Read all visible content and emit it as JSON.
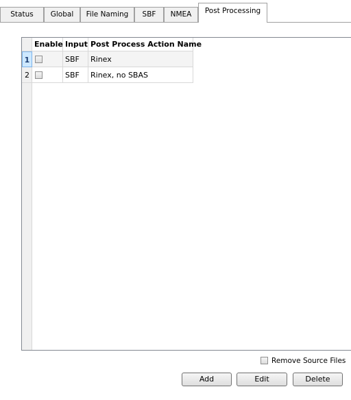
{
  "tabs": [
    {
      "label": "Status"
    },
    {
      "label": "Global"
    },
    {
      "label": "File Naming"
    },
    {
      "label": "SBF"
    },
    {
      "label": "NMEA"
    },
    {
      "label": "Post Processing",
      "active": true
    }
  ],
  "table": {
    "columns": [
      "Enable",
      "Input",
      "Post Process Action Name"
    ],
    "rows": [
      {
        "num": "1",
        "enabled": false,
        "input": "SBF",
        "name": "Rinex"
      },
      {
        "num": "2",
        "enabled": false,
        "input": "SBF",
        "name": "Rinex, no SBAS"
      }
    ]
  },
  "options": {
    "remove_source_files_label": "Remove Source Files",
    "remove_source_files_checked": false
  },
  "buttons": {
    "add": "Add",
    "edit": "Edit",
    "delete": "Delete"
  }
}
